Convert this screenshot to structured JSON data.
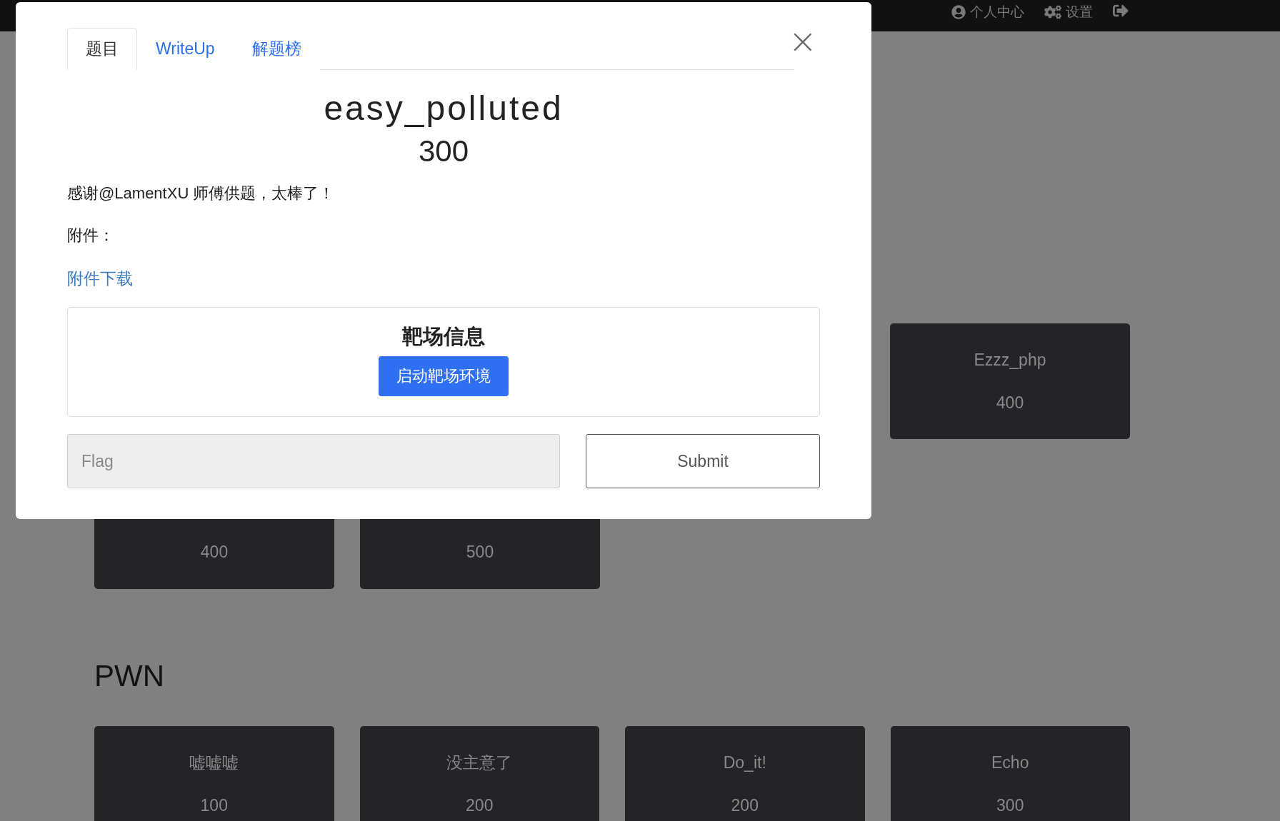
{
  "navbar": {
    "items": [
      {
        "kind": "user",
        "label": "个人中心"
      },
      {
        "kind": "settings",
        "label": "设置"
      },
      {
        "kind": "logout"
      }
    ]
  },
  "background": {
    "rows": [
      {
        "cards": [
          {
            "name": "Ezzz_php",
            "score": "400"
          }
        ]
      },
      {
        "cards": [
          {
            "score": "400"
          },
          {
            "score": "500"
          }
        ]
      }
    ],
    "sections": [
      {
        "heading": "PWN",
        "cards": [
          {
            "name": "嘘嘘嘘",
            "score": "100"
          },
          {
            "name": "没主意了",
            "score": "200"
          },
          {
            "name": "Do_it!",
            "score": "200"
          },
          {
            "name": "Echo",
            "score": "300"
          }
        ]
      }
    ]
  },
  "modal": {
    "tabs": [
      {
        "label": "题目",
        "selected": true
      },
      {
        "label": "WriteUp",
        "selected": false
      },
      {
        "label": "解题榜",
        "selected": false
      }
    ],
    "close": "×",
    "title": "easy_polluted",
    "score": "300",
    "description": "感谢@LamentXU 师傅供题，太棒了！",
    "attachment_label": "附件：",
    "attachment_link": "附件下载",
    "range": {
      "heading": "靶场信息",
      "button": "启动靶场环境"
    },
    "flag": {
      "placeholder": "Flag"
    },
    "submit": "Submit"
  }
}
